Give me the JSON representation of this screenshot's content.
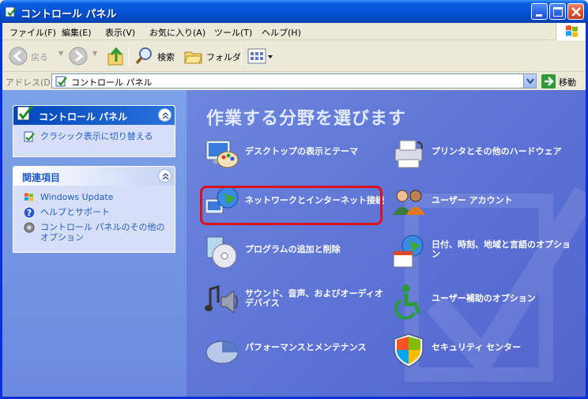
{
  "window": {
    "title": "コントロール パネル"
  },
  "menu": [
    "ファイル(F)",
    "編集(E)",
    "表示(V)",
    "お気に入り(A)",
    "ツール(T)",
    "ヘルプ(H)"
  ],
  "toolbar": {
    "back": "戻る",
    "search": "検索",
    "folders": "フォルダ"
  },
  "address": {
    "label": "アドレス(D)",
    "value": "コントロール パネル",
    "go": "移動"
  },
  "sidebar": {
    "panel": {
      "title": "コントロール パネル",
      "link": "クラシック表示に切り替える"
    },
    "related": {
      "title": "関連項目",
      "links": [
        "Windows Update",
        "ヘルプとサポート",
        "コントロール パネルのその他のオプション"
      ]
    }
  },
  "main": {
    "heading": "作業する分野を選びます",
    "categories": [
      {
        "label": "デスクトップの表示とテーマ",
        "icon": "desktop-theme-icon"
      },
      {
        "label": "プリンタとその他のハードウェア",
        "icon": "printer-icon"
      },
      {
        "label": "ネットワークとインターネット接続",
        "icon": "network-icon"
      },
      {
        "label": "ユーザー アカウント",
        "icon": "user-accounts-icon"
      },
      {
        "label": "プログラムの追加と削除",
        "icon": "add-remove-programs-icon"
      },
      {
        "label": "日付、時刻、地域と言語のオプション",
        "icon": "date-time-globe-icon"
      },
      {
        "label": "サウンド、音声、およびオーディオ デバイス",
        "icon": "sound-icon"
      },
      {
        "label": "ユーザー補助のオプション",
        "icon": "accessibility-icon"
      },
      {
        "label": "パフォーマンスとメンテナンス",
        "icon": "performance-icon"
      },
      {
        "label": "セキュリティ センター",
        "icon": "security-shield-icon"
      }
    ]
  },
  "colors": {
    "highlight": "#e0101a",
    "title_bar": "#0453d6",
    "content_bg": "#5c73d8"
  }
}
